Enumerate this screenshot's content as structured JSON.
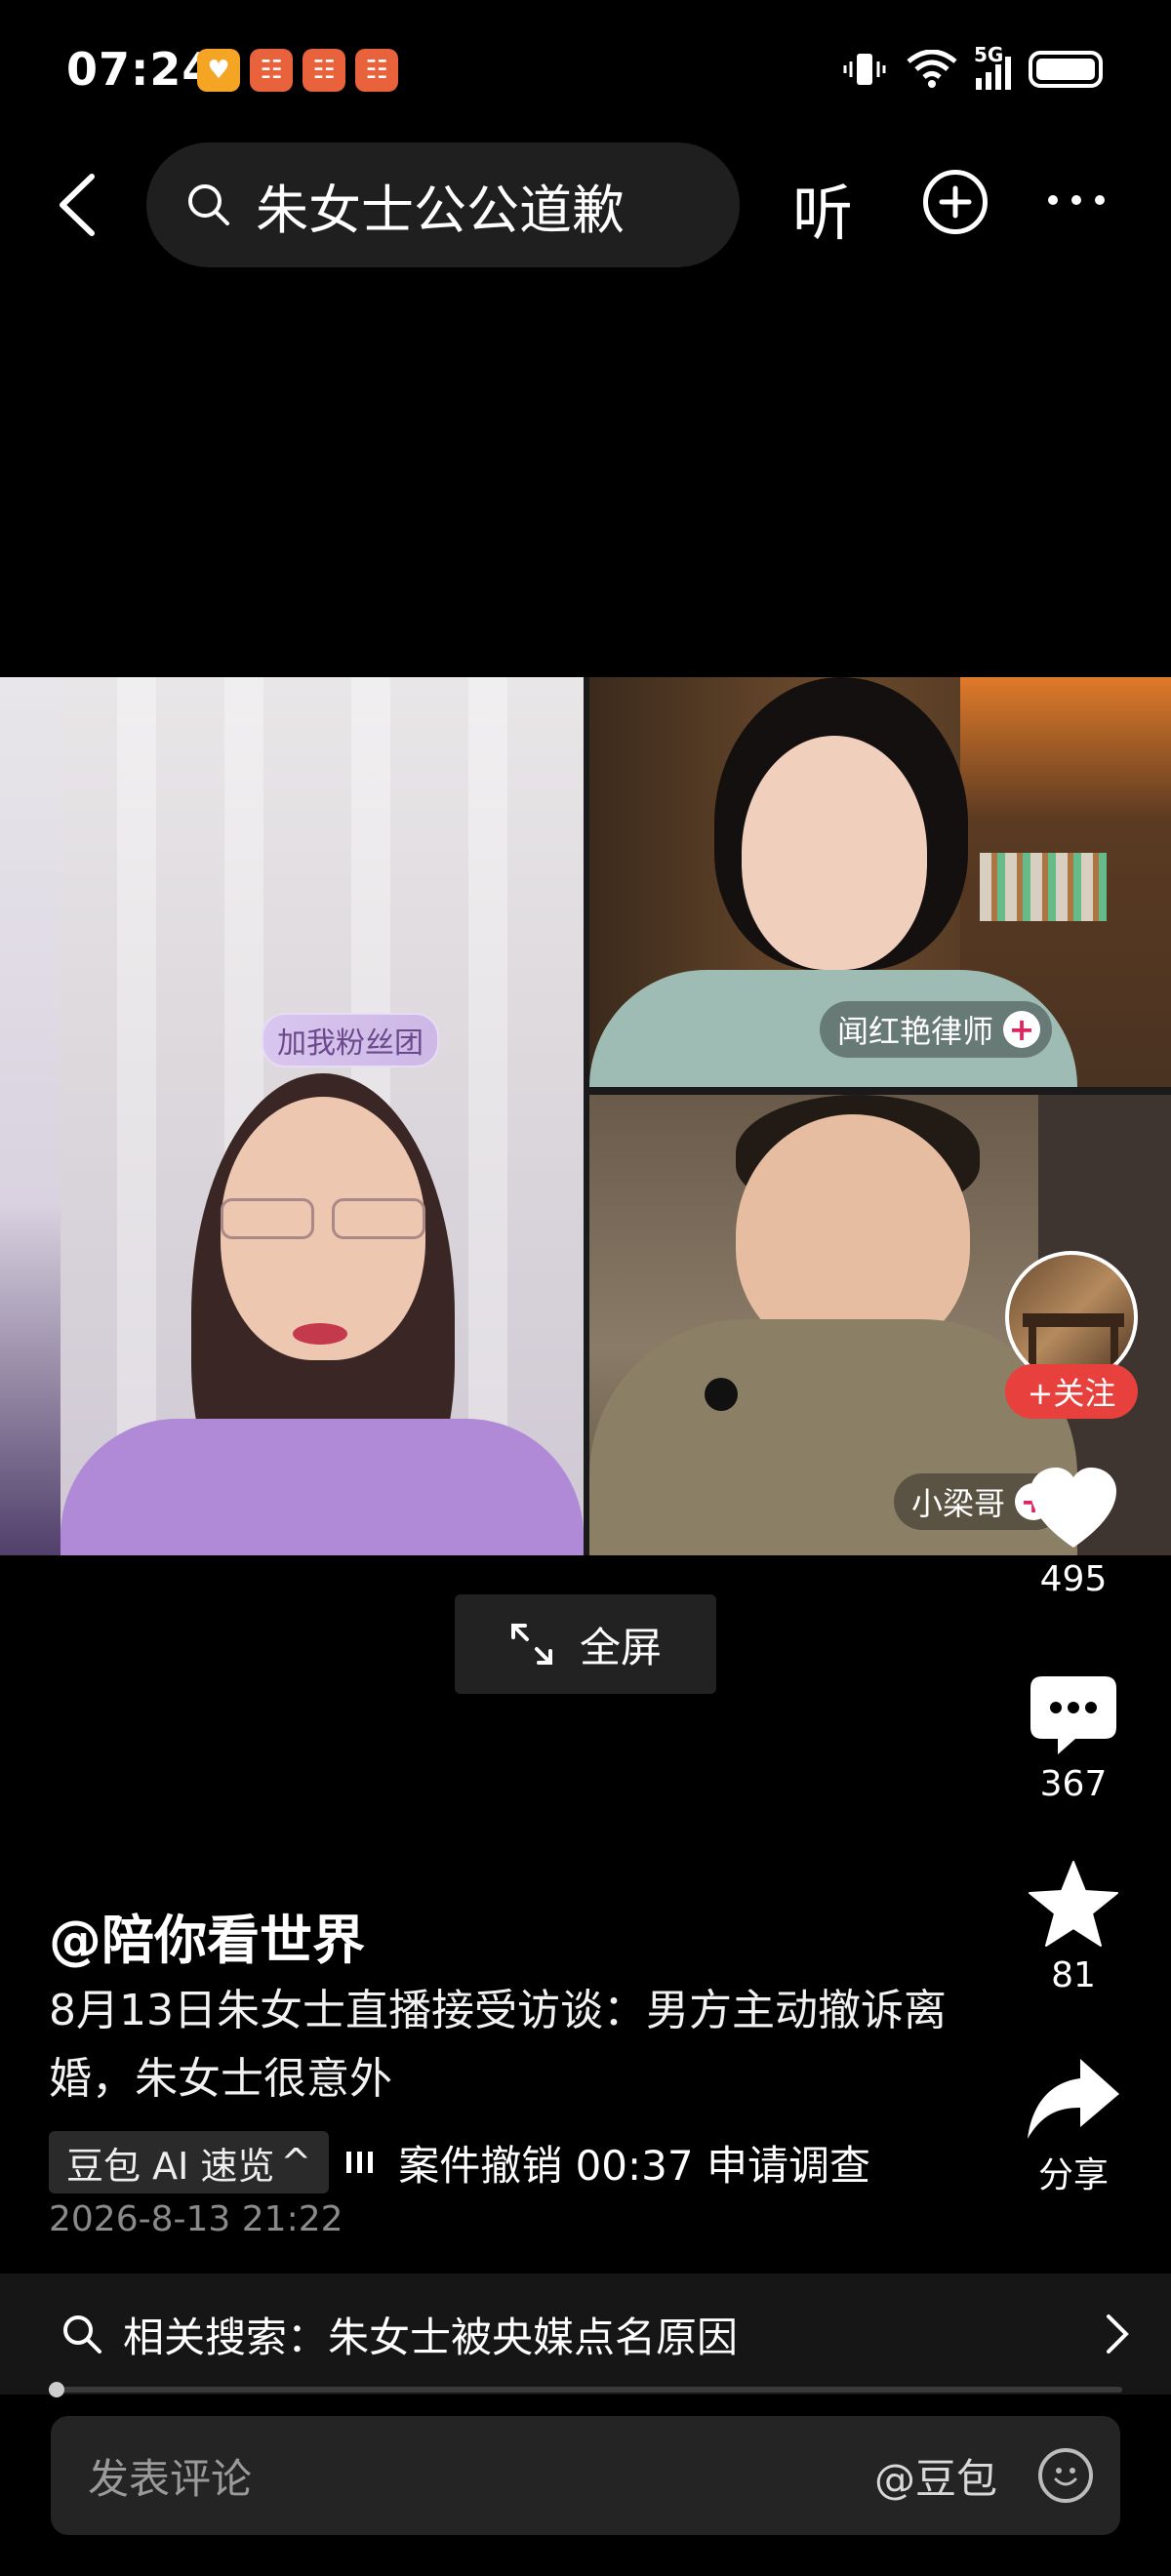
{
  "status_bar": {
    "time": "07:24",
    "network": "5G",
    "notification_icons": [
      "heart-app-icon",
      "app-icon",
      "app-icon",
      "app-icon"
    ]
  },
  "nav": {
    "search_query": "朱女士公公道歉",
    "listen_label": "听"
  },
  "video": {
    "fan_badge": "加我粉丝团",
    "guest1_name": "闻红艳律师",
    "guest2_name": "小梁哥",
    "fullscreen_label": "全屏"
  },
  "actions": {
    "follow_label": "+关注",
    "likes": "495",
    "comments": "367",
    "favorites": "81",
    "share_label": "分享"
  },
  "post": {
    "author": "@陪你看世界",
    "caption": "8月13日朱女士直播接受访谈：男方主动撤诉离婚，朱女士很意外",
    "ai_chip": "豆包 AI 速览",
    "ai_ticker": "案件撤销    00:37 申请调查",
    "timestamp": "2026-8-13 21:22"
  },
  "related": {
    "text": "相关搜索：朱女士被央媒点名原因"
  },
  "progress": {
    "fraction": 0.005
  },
  "comment": {
    "placeholder": "发表评论",
    "mention": "@豆包"
  }
}
